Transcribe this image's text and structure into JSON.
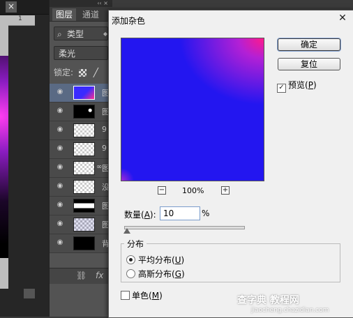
{
  "canvas": {
    "ruler_mark": "1",
    "close": "×"
  },
  "panel": {
    "window_controls": "‹‹ ×",
    "tabs": [
      {
        "label": "图层"
      },
      {
        "label": "通道"
      }
    ],
    "filter_label": "类型",
    "blend_mode": "柔光",
    "lock_label": "锁定:",
    "layers": [
      {
        "name": "图",
        "thumb": "blue"
      },
      {
        "name": "图",
        "thumb": "dot"
      },
      {
        "name": "9",
        "thumb": "check"
      },
      {
        "name": "9",
        "thumb": "check"
      },
      {
        "name": "图",
        "thumb": "check"
      },
      {
        "name": "没",
        "thumb": "check"
      },
      {
        "name": "图",
        "thumb": "stripe"
      },
      {
        "name": "图",
        "thumb": "checkblue"
      },
      {
        "name": "背",
        "thumb": "black"
      }
    ],
    "bottom_icons": [
      "link-icon",
      "fx-icon"
    ],
    "fx_label": "fx"
  },
  "dialog": {
    "title": "添加杂色",
    "ok_label": "确定",
    "reset_label": "复位",
    "preview_label": "预览",
    "preview_key": "P",
    "preview_checked": true,
    "zoom": "100%",
    "amount_label": "数量",
    "amount_key": "A",
    "amount_value": "10",
    "amount_unit": "%",
    "distribution_label": "分布",
    "uniform_label": "平均分布",
    "uniform_key": "U",
    "gaussian_label": "高斯分布",
    "gaussian_key": "G",
    "mono_label": "单色",
    "mono_key": "M",
    "selected_distribution": "uniform",
    "preview_colors": {
      "base": "#2316f0",
      "corner": "#ff1a8a"
    }
  },
  "watermark": {
    "main": "查字典 教程网",
    "sub": "jiaocheng.chazidian.com"
  }
}
